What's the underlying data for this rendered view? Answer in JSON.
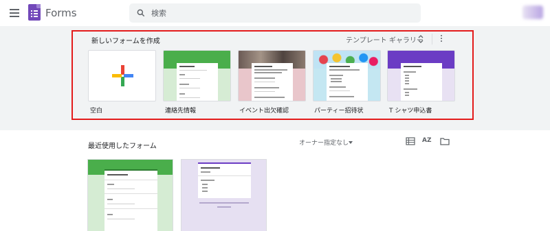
{
  "header": {
    "app_title": "Forms",
    "search_placeholder": "検索",
    "icons": {
      "menu": "hamburger-menu-icon",
      "logo": "forms-logo-icon",
      "search": "search-icon"
    }
  },
  "templates": {
    "section_title": "新しいフォームを作成",
    "gallery_label": "テンプレート ギャラリー",
    "items": [
      {
        "label": "空白"
      },
      {
        "label": "連絡先情報"
      },
      {
        "label": "イベント出欠確認"
      },
      {
        "label": "パーティー招待状"
      },
      {
        "label": "T シャツ申込書"
      }
    ]
  },
  "recent": {
    "section_title": "最近使用したフォーム",
    "owner_filter": "オーナー指定なし",
    "sort_label": "AZ"
  },
  "colors": {
    "highlight_border": "#e31a1a",
    "band_background": "#f1f3f4",
    "forms_purple": "#7248b9",
    "plus_red": "#ea4335",
    "plus_yellow": "#fbbc04",
    "plus_green": "#34a853",
    "plus_blue": "#4285f4"
  }
}
